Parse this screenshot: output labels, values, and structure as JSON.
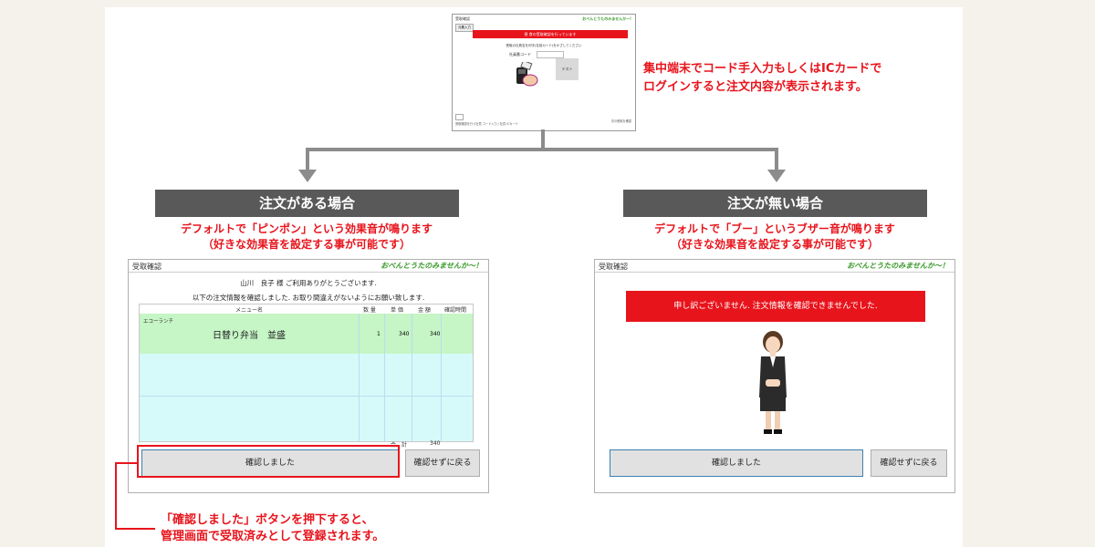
{
  "top_screen": {
    "title": "受取確認",
    "brand_url": "おべんとうたのみませんか〜!",
    "button": "元素入力",
    "red_bar": "昼 食の受取確認を行っています",
    "instruction": "受取の社員名を印字(名前カード)をかざしてください",
    "code_label": "社員番コード",
    "test_button": "テスト",
    "footer_left": "受取確認を行う社員 コード入力 / 社員 ICカード",
    "footer_right": "次の受取を確認"
  },
  "top_annotation": {
    "line1": "集中端末でコード手入力もしくはICカードで",
    "line2": "ログインすると注文内容が表示されます。"
  },
  "left": {
    "header": "注文がある場合",
    "desc1": "デフォルトで「ピンポン」という効果音が鳴ります",
    "desc2": "（好きな効果音を設定する事が可能です）",
    "window": {
      "title": "受取確認",
      "brand": "おべんとうたのみませんか〜！",
      "greeting1": "山川　良子 様 ご利用ありがとうございます.",
      "greeting2": "以下の注文情報を確認しました. お取り間違えがないようにお願い致します.",
      "columns": [
        "メニュー名",
        "数 量",
        "単 価",
        "金 額",
        "確認時間"
      ],
      "row": {
        "category": "エコーランチ",
        "name": "日替り弁当　並盛",
        "qty": "1",
        "price": "340",
        "amount": "340",
        "time": ""
      },
      "total_label": "合　計",
      "total_value": "340",
      "confirm_button": "確認しました",
      "back_button": "確認せずに戻る"
    }
  },
  "right": {
    "header": "注文が無い場合",
    "desc1": "デフォルトで「ブー」というブザー音が鳴ります",
    "desc2": "（好きな効果音を設定する事が可能です）",
    "window": {
      "title": "受取確認",
      "brand": "おべんとうたのみませんか〜！",
      "error": "申し訳ございません. 注文情報を確認できませんでした.",
      "confirm_button": "確認しました",
      "back_button": "確認せずに戻る"
    }
  },
  "bottom_annotation": {
    "line1": "「確認しました」ボタンを押下すると、",
    "line2": "管理画面で受取済みとして登録されます。"
  },
  "colors": {
    "red": "#e8141c",
    "header_gray": "#595959",
    "row_green": "#c6f5c6",
    "row_cyan": "#d6fafa"
  }
}
